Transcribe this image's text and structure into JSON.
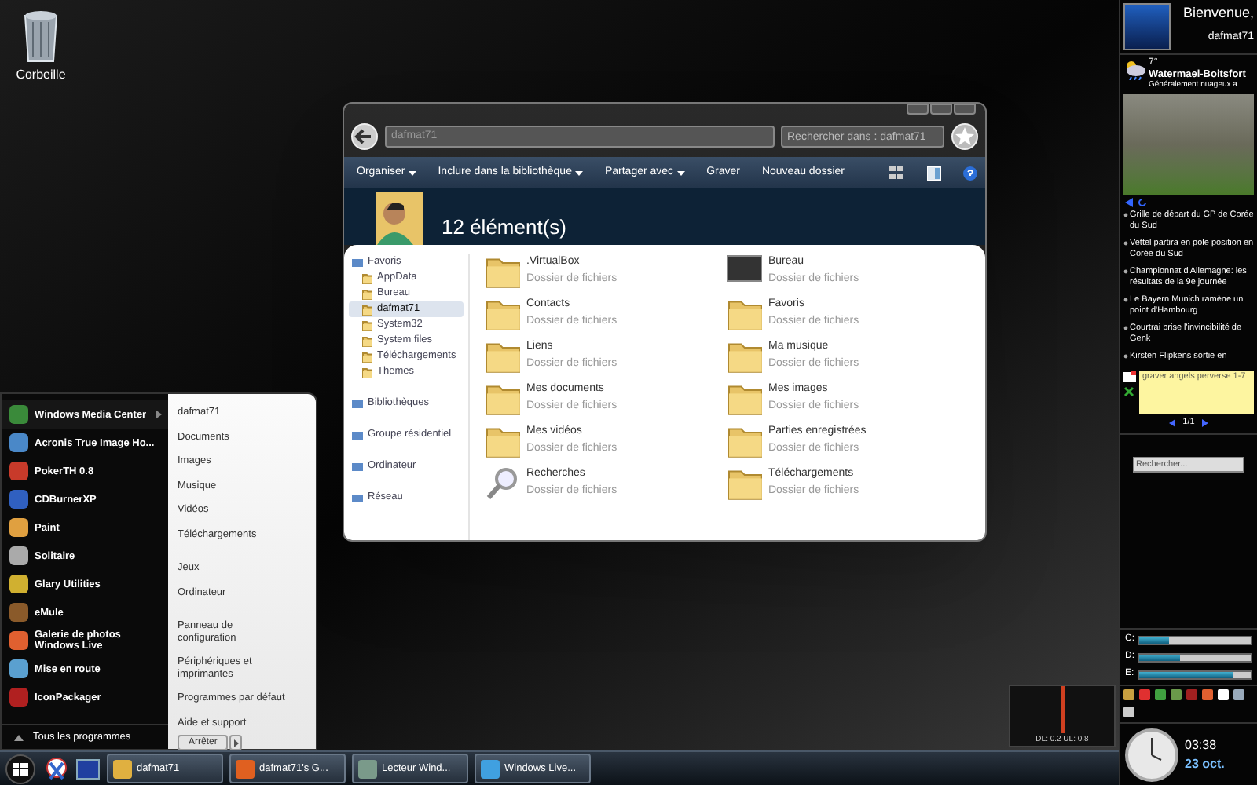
{
  "desktop": {
    "icons": [
      {
        "label": "Corbeille"
      }
    ]
  },
  "explorer": {
    "address": "dafmat71",
    "search_placeholder": "Rechercher dans : dafmat71",
    "toolbar": [
      {
        "label": "Organiser",
        "dropdown": true
      },
      {
        "label": "Inclure dans la bibliothèque",
        "dropdown": true
      },
      {
        "label": "Partager avec",
        "dropdown": true
      },
      {
        "label": "Graver",
        "dropdown": false
      },
      {
        "label": "Nouveau dossier",
        "dropdown": false
      }
    ],
    "count": "12 élément(s)",
    "nav": [
      {
        "label": "Favoris",
        "selected": false,
        "children": [
          {
            "label": "AppData",
            "selected": false
          },
          {
            "label": "Bureau",
            "selected": false
          },
          {
            "label": "dafmat71",
            "selected": true
          },
          {
            "label": "System32",
            "selected": false
          },
          {
            "label": "System files",
            "selected": false
          },
          {
            "label": "Téléchargements",
            "selected": false
          },
          {
            "label": "Themes",
            "selected": false
          }
        ]
      },
      {
        "label": "Bibliothèques",
        "selected": false
      },
      {
        "label": "Groupe résidentiel",
        "selected": false
      },
      {
        "label": "Ordinateur",
        "selected": false
      },
      {
        "label": "Réseau",
        "selected": false
      }
    ],
    "items": [
      {
        "name": ".VirtualBox",
        "type": "Dossier de fichiers"
      },
      {
        "name": "Bureau",
        "type": "Dossier de fichiers"
      },
      {
        "name": "Contacts",
        "type": "Dossier de fichiers"
      },
      {
        "name": "Favoris",
        "type": "Dossier de fichiers"
      },
      {
        "name": "Liens",
        "type": "Dossier de fichiers"
      },
      {
        "name": "Ma musique",
        "type": "Dossier de fichiers"
      },
      {
        "name": "Mes documents",
        "type": "Dossier de fichiers"
      },
      {
        "name": "Mes images",
        "type": "Dossier de fichiers"
      },
      {
        "name": "Mes vidéos",
        "type": "Dossier de fichiers"
      },
      {
        "name": "Parties enregistrées",
        "type": "Dossier de fichiers"
      },
      {
        "name": "Recherches",
        "type": "Dossier de fichiers"
      },
      {
        "name": "Téléchargements",
        "type": "Dossier de fichiers"
      }
    ]
  },
  "start_menu": {
    "programs": [
      {
        "label": "Windows Media Center",
        "submenu": true
      },
      {
        "label": "Acronis True Image Ho...",
        "submenu": false
      },
      {
        "label": "PokerTH 0.8",
        "submenu": false
      },
      {
        "label": "CDBurnerXP",
        "submenu": false
      },
      {
        "label": "Paint",
        "submenu": false
      },
      {
        "label": "Solitaire",
        "submenu": false
      },
      {
        "label": "Glary Utilities",
        "submenu": false
      },
      {
        "label": "eMule",
        "submenu": false
      },
      {
        "label": "Galerie de photos Windows Live",
        "submenu": false
      },
      {
        "label": "Mise en route",
        "submenu": false
      },
      {
        "label": "IconPackager",
        "submenu": false
      }
    ],
    "all_programs": "Tous les programmes",
    "places": [
      [
        {
          "label": "dafmat71"
        },
        {
          "label": "Documents"
        },
        {
          "label": "Images"
        },
        {
          "label": "Musique"
        },
        {
          "label": "Vidéos"
        },
        {
          "label": "Téléchargements"
        }
      ],
      [
        {
          "label": "Jeux"
        },
        {
          "label": "Ordinateur"
        }
      ],
      [
        {
          "label": "Panneau de configuration"
        },
        {
          "label": "Périphériques et imprimantes"
        },
        {
          "label": "Programmes par défaut"
        },
        {
          "label": "Aide et support"
        }
      ]
    ],
    "shutdown": "Arrêter"
  },
  "taskbar": {
    "tasks": [
      {
        "label": "dafmat71"
      },
      {
        "label": "dafmat71's G..."
      },
      {
        "label": "Lecteur Wind..."
      },
      {
        "label": "Windows Live..."
      }
    ]
  },
  "net_meter": {
    "reading": "DL: 0.2 UL: 0.8"
  },
  "sidebar": {
    "welcome": "Bienvenue,",
    "user": "dafmat71",
    "weather": {
      "temperature": "7°",
      "city": "Watermael-Boitsfort",
      "condition": "Généralement nuageux a..."
    },
    "news": [
      {
        "text": "Grille de départ du GP de Corée du Sud"
      },
      {
        "text": "Vettel partira en pole position en Corée du Sud"
      },
      {
        "text": "Championnat d'Allemagne: les résultats de la  9e journée"
      },
      {
        "text": "Le Bayern Munich ramène un point d'Hambourg"
      },
      {
        "text": "Courtrai brise l'invincibilité de Genk"
      },
      {
        "text": "Kirsten Flipkens sortie en"
      }
    ],
    "note": {
      "text": "graver angels perverse 1-7",
      "pager": "1/1"
    },
    "search_placeholder": "Rechercher...",
    "drives": [
      {
        "label": "C:",
        "level": 0.27
      },
      {
        "label": "D:",
        "level": 0.37
      },
      {
        "label": "E:",
        "level": 0.84
      }
    ],
    "clock": {
      "time": "03:38",
      "date": "23 oct."
    }
  }
}
